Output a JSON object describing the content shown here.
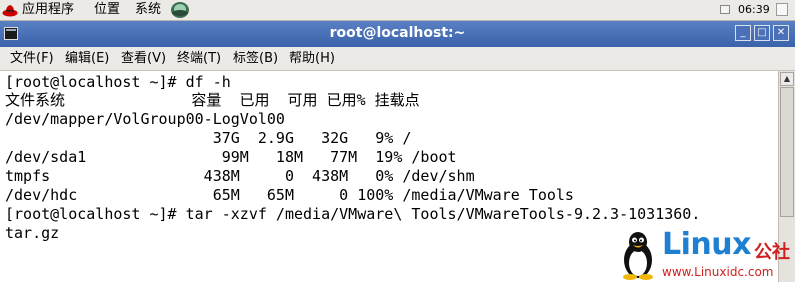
{
  "panel": {
    "menus": [
      "应用程序",
      "位置",
      "系统"
    ],
    "clock": "06:39"
  },
  "window": {
    "title": "root@localhost:~",
    "buttons": [
      "_",
      "□",
      "✕"
    ]
  },
  "menubar": {
    "items": [
      "文件(F)",
      "编辑(E)",
      "查看(V)",
      "终端(T)",
      "标签(B)",
      "帮助(H)"
    ]
  },
  "terminal": {
    "lines": [
      "[root@localhost ~]# df -h",
      "文件系统              容量  已用  可用 已用% 挂载点",
      "/dev/mapper/VolGroup00-LogVol00",
      "                       37G  2.9G   32G   9% /",
      "/dev/sda1               99M   18M   77M  19% /boot",
      "tmpfs                 438M     0  438M   0% /dev/shm",
      "/dev/hdc               65M   65M     0 100% /media/VMware Tools",
      "[root@localhost ~]# tar -xzvf /media/VMware\\ Tools/VMwareTools-9.2.3-1031360.",
      "tar.gz"
    ]
  },
  "watermark": {
    "brand": "Linux",
    "brand_cn": "公社",
    "url": "www.Linuxidc.com",
    "colors": {
      "brand": "#1f7fd0",
      "accent": "#d02020"
    }
  }
}
